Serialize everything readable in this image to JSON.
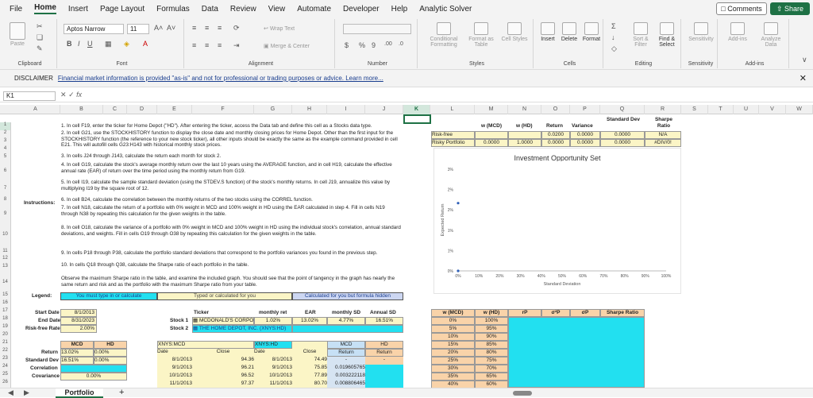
{
  "menu": {
    "items": [
      "File",
      "Home",
      "Insert",
      "Page Layout",
      "Formulas",
      "Data",
      "Review",
      "View",
      "Automate",
      "Developer",
      "Help",
      "Analytic Solver"
    ],
    "comments": "Comments",
    "share": "Share"
  },
  "ribbon": {
    "paste": "Paste",
    "clipboard": "Clipboard",
    "font_name": "Aptos Narrow",
    "font_size": "11",
    "font": "Font",
    "wrap_text": "Wrap Text",
    "merge_center": "Merge & Center",
    "alignment": "Alignment",
    "number": "Number",
    "cond_format": "Conditional Formatting",
    "format_table": "Format as Table",
    "cell_styles": "Cell Styles",
    "styles": "Styles",
    "insert": "Insert",
    "delete": "Delete",
    "format": "Format",
    "cells": "Cells",
    "sort_filter": "Sort & Filter",
    "find_select": "Find & Select",
    "editing": "Editing",
    "sensitivity": "Sensitivity",
    "add_ins": "Add-ins",
    "analyze_data": "Analyze Data",
    "sensitivity_grp": "Sensitivity",
    "add_ins_grp": "Add-ins"
  },
  "disclaimer": {
    "label": "DISCLAIMER",
    "text": "Financial market information is provided \"as-is\" and not for professional or trading purposes or advice. Learn more..."
  },
  "formula_bar": {
    "name_box": "K1",
    "fx": "fx"
  },
  "columns": [
    "A",
    "B",
    "C",
    "D",
    "E",
    "F",
    "G",
    "H",
    "I",
    "J",
    "K",
    "L",
    "M",
    "N",
    "O",
    "P",
    "Q",
    "R",
    "S",
    "T",
    "U",
    "V",
    "W"
  ],
  "rows": [
    "1",
    "2",
    "3",
    "4",
    "5",
    "6",
    "7",
    "8",
    "9",
    "10",
    "11",
    "12",
    "13",
    "14",
    "15",
    "16",
    "17",
    "18",
    "19",
    "20",
    "21",
    "22",
    "23",
    "24",
    "25",
    "26"
  ],
  "instructions": {
    "label": "Instructions:",
    "lines": [
      "1. In cell F19, enter the ticker for Home Depot (\"HD\"). After entering the ticker, access the Data tab and define this cell as a Stocks data type.",
      "2. In cell G21, use the STOCKHISTORY function to display the close date and monthly closing prices for Home Depot. Other than the first input for the STOCKHISTORY function (the reference to your new stock ticker), all other inputs should be exactly the same as the example command provided in cell E21. This will autofill cells G23:H143 with historical monthly stock prices.",
      "3. In cells J24 through J143, calculate the return each month for stock 2.",
      "4. In cell G19, calculate the stock's average monthly return over the last 10 years using the AVERAGE function, and in cell H19, calculate the effective annual rate (EAR) of return over the time period using the monthly return from G19.",
      "5. In cell I19, calculate the sample standard deviation (using the STDEV.S function) of the stock's monthly returns. In cell J19, annualize this value by multiplying I19 by the square root of 12.",
      "6. In cell B24, calculate the correlation between the monthly returns of the two stocks using the CORREL function.",
      "7. In cell N18, calculate the return of a portfolio with 0% weight in MCD and 100% weight in HD using the EAR calculated in step 4. Fill in cells N19 through N38 by repeating this calculation for the given weights in the table.",
      "8. In cell O18, calculate the variance of a portfolio with 0% weight in MCD and 100% weight in HD using the individual stock's correlation, annual standard deviations, and weights. Fill in cells O19 through O38 by repeating this calculation for the given weights in the table.",
      "9. In cells P18 through P38, calculate the portfolio standard deviations that correspond to the portfolio variances you found in the previous step.",
      "10. In cells Q18 through Q38, calculate the Sharpe ratio of each portfolio in the table.",
      "Observe the maximum Sharpe ratio in the table, and examine the included graph. You should see that the point of tangency in the graph has nearly the same return and risk and as the portfolio with the maximum Sharpe ratio from your table."
    ]
  },
  "legend": {
    "label": "Legend:",
    "input": "You must type in or calculate",
    "typed": "Typed or calculated for you",
    "calc": "Calculated for you but formula hidden"
  },
  "dates": {
    "start_label": "Start Date",
    "start": "8/1/2013",
    "end_label": "End Date",
    "end": "8/31/2023",
    "rf_label": "Risk-free Rate",
    "rf": "2.00%"
  },
  "stocks": {
    "headers": [
      "Ticker",
      "monthly ret",
      "EAR",
      "monthly SD",
      "Annual SD"
    ],
    "s1_label": "Stock 1",
    "s1_name": "MCDONALD'S CORPO",
    "s1_mret": "1.02%",
    "s1_ear": "13.02%",
    "s1_msd": "4.77%",
    "s1_asd": "16.51%",
    "s2_label": "Stock 2",
    "s2_name": "THE HOME DEPOT, INC. (XNYS:HD)"
  },
  "stats": {
    "mcd": "MCD",
    "hd": "HD",
    "return_label": "Return",
    "mcd_ret": "13.02%",
    "hd_ret": "0.00%",
    "sd_label": "Standard Dev",
    "mcd_sd": "16.51%",
    "hd_sd": "0.00%",
    "corr_label": "Correlation",
    "cov_label": "Covariance",
    "cov": "0.00%"
  },
  "history": {
    "mcd_title": "XNYS:MCD",
    "hd_title": "XNYS:HD",
    "date_h": "Date",
    "close_h": "Close",
    "ret_h1": "MCD",
    "ret_h2": "Return",
    "ret_h3": "HD",
    "ret_h4": "Return",
    "rows": [
      {
        "d1": "8/1/2013",
        "c1": "94.36",
        "d2": "8/1/2013",
        "c2": "74.49",
        "r1": "-",
        "r2": "-"
      },
      {
        "d1": "9/1/2013",
        "c1": "96.21",
        "d2": "9/1/2013",
        "c2": "75.85",
        "r1": "0.019605765",
        "r2": ""
      },
      {
        "d1": "10/1/2013",
        "c1": "96.52",
        "d2": "10/1/2013",
        "c2": "77.89",
        "r1": "0.003222118",
        "r2": ""
      },
      {
        "d1": "11/1/2013",
        "c1": "97.37",
        "d2": "11/1/2013",
        "c2": "80.70",
        "r1": "0.008806465",
        "r2": ""
      }
    ]
  },
  "summary": {
    "headers": [
      "w (MCD)",
      "w (HD)",
      "Return",
      "Variance",
      "Standard Dev",
      "Sharpe Ratio"
    ],
    "rf_label": "Risk-free",
    "rf_ret": "0.0200",
    "rf_var": "0.0000",
    "rf_sd": "0.0000",
    "rf_sharpe": "N/A",
    "rp_label": "Risky Portfolio",
    "rp_wm": "0.0000",
    "rp_wh": "1.0000",
    "rp_ret": "0.0000",
    "rp_var": "0.0000",
    "rp_sd": "0.0000",
    "rp_sharpe": "#DIV/0!"
  },
  "port_table": {
    "headers": [
      "w (MCD)",
      "w (HD)",
      "rP",
      "σ²P",
      "σP",
      "Sharpe Ratio"
    ],
    "wm": [
      "0%",
      "5%",
      "10%",
      "15%",
      "20%",
      "25%",
      "30%",
      "35%",
      "40%"
    ],
    "wh": [
      "100%",
      "95%",
      "90%",
      "85%",
      "80%",
      "75%",
      "70%",
      "65%",
      "60%"
    ]
  },
  "chart_data": {
    "type": "scatter",
    "title": "Investment Opportunity Set",
    "xlabel": "Standard Deviation",
    "ylabel": "Expected Return",
    "x_ticks": [
      "0%",
      "10%",
      "20%",
      "30%",
      "40%",
      "50%",
      "60%",
      "70%",
      "80%",
      "90%",
      "100%"
    ],
    "y_ticks": [
      "0%",
      "1%",
      "1%",
      "2%",
      "2%",
      "3%"
    ],
    "xlim": [
      0,
      1
    ],
    "ylim": [
      0,
      0.03
    ],
    "points": [
      {
        "x": 0,
        "y": 0.02
      },
      {
        "x": 0,
        "y": 0
      }
    ]
  },
  "sheet_tab": "Portfolio"
}
